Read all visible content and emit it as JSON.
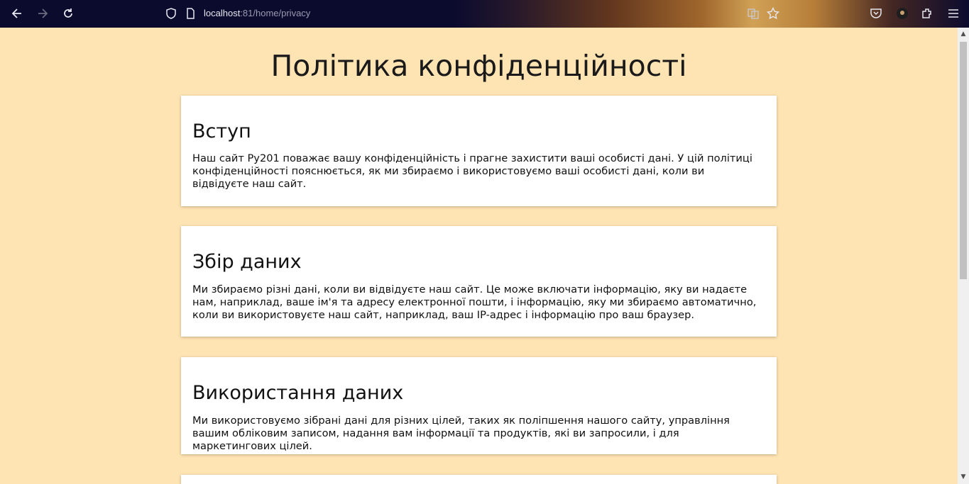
{
  "browser": {
    "url_host": "localhost",
    "url_path": ":81/home/privacy"
  },
  "page": {
    "title": "Політика конфіденційності",
    "sections": [
      {
        "heading": "Вступ",
        "text": "Наш сайт Py201 поважає вашу конфіденційність і прагне захистити ваші особисті дані. У цій політиці конфіденційності пояснюється, як ми збираємо і використовуємо ваші особисті дані, коли ви відвідуєте наш сайт."
      },
      {
        "heading": "Збір даних",
        "text": "Ми збираємо різні дані, коли ви відвідуєте наш сайт. Це може включати інформацію, яку ви надаєте нам, наприклад, ваше ім'я та адресу електронної пошти, і інформацію, яку ми збираємо автоматично, коли ви використовуєте наш сайт, наприклад, ваш IP-адрес і інформацію про ваш браузер."
      },
      {
        "heading": "Використання даних",
        "text": "Ми використовуємо зібрані дані для різних цілей, таких як поліпшення нашого сайту, управління вашим обліковим записом, надання вам інформації та продуктів, які ви запросили, і для маркетингових цілей."
      }
    ]
  },
  "colors": {
    "page_background": "#ffe4b3",
    "card_background": "#ffffff",
    "toolbar_background": "#0b0b2e"
  }
}
